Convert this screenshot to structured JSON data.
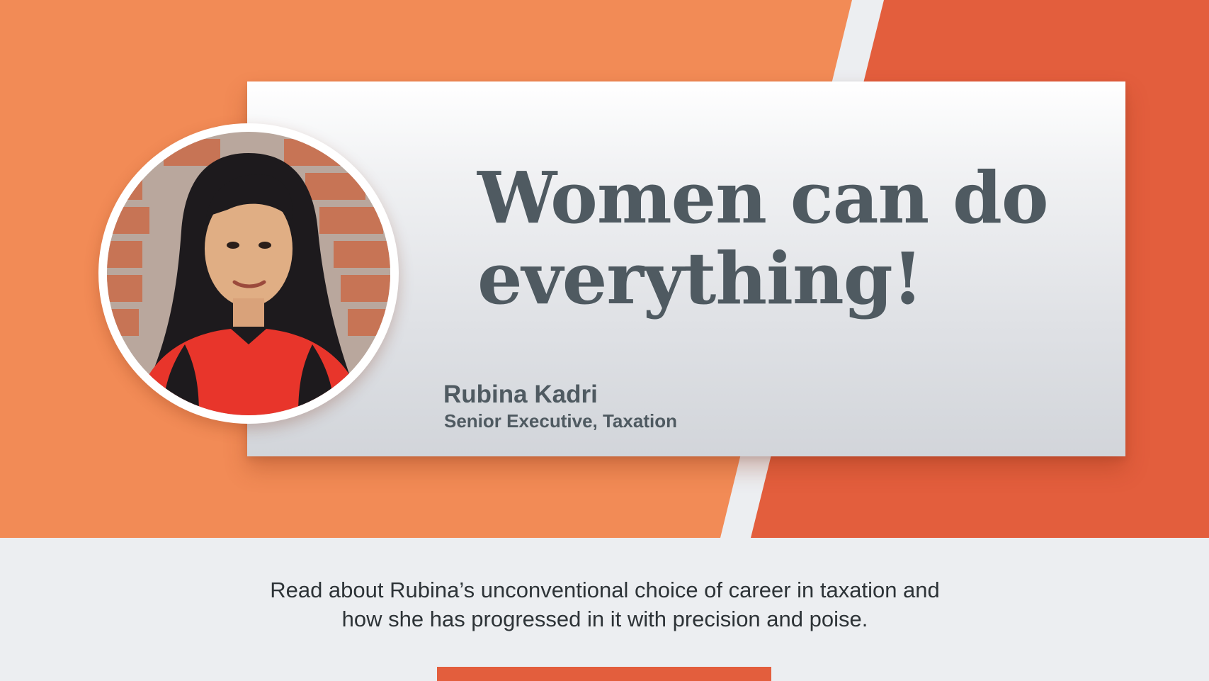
{
  "colors": {
    "orange_light": "#f28b56",
    "orange_dark": "#e35e3d",
    "stripe": "#eceef1",
    "text_dark": "#4f5a61",
    "text_body": "#2d3337"
  },
  "feature": {
    "headline_line1": "Women can do",
    "headline_line2": "everything!",
    "name": "Rubina Kadri",
    "role": "Senior Executive, Taxation",
    "photo_icon": "portrait-photo"
  },
  "description": {
    "line1": "Read about Rubina’s unconventional choice of career in taxation and",
    "line2": "how she has progressed in it with precision and poise."
  }
}
